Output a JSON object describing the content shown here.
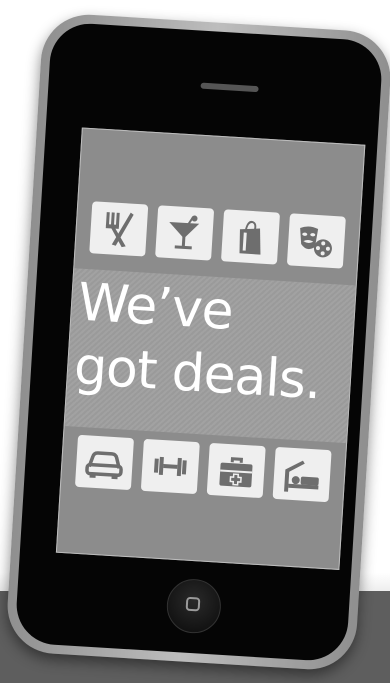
{
  "headline": {
    "line1": "We’ve",
    "line2": "got deals."
  },
  "top_icons": [
    "utensils-icon",
    "cocktail-icon",
    "shopping-bag-icon",
    "theater-film-icon"
  ],
  "bottom_icons": [
    "car-icon",
    "dumbbell-icon",
    "first-aid-kit-icon",
    "bed-icon"
  ],
  "colors": {
    "screen": "#8c8c8c",
    "band": "#9a9a9a",
    "tile": "#efefef",
    "icon": "#6e6e6e",
    "text": "#ffffff",
    "phone_body": "#050505",
    "bezel": "#a8a8a8",
    "floor": "#5e5e5e"
  }
}
